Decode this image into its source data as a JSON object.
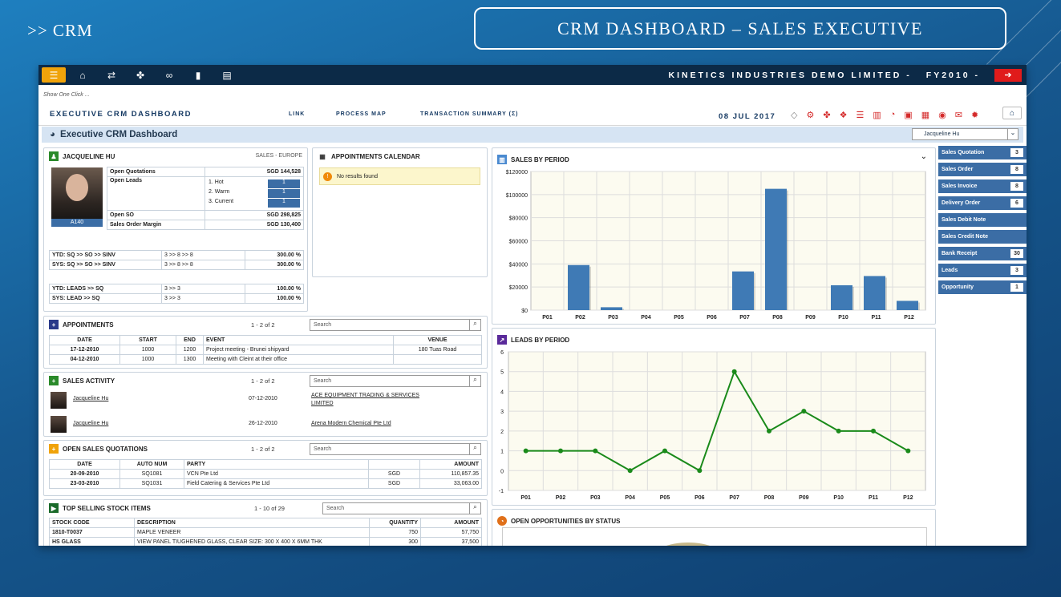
{
  "slide": {
    "title": ">> CRM",
    "banner": "CRM DASHBOARD – SALES EXECUTIVE"
  },
  "topbar": {
    "company": "KINETICS INDUSTRIES DEMO LIMITED -",
    "fy": "FY2010 -"
  },
  "header": {
    "hint": "Show One Click ...",
    "dashboard_title": "EXECUTIVE CRM DASHBOARD",
    "links": [
      "LINK",
      "PROCESS MAP",
      "TRANSACTION SUMMARY (Σ)"
    ],
    "date": "08 JUL 2017"
  },
  "band": {
    "title": "Executive CRM Dashboard",
    "user_select": "Jacqueline Hu"
  },
  "profile": {
    "name": "JACQUELINE HU",
    "region": "SALES - EUROPE",
    "badge": "A140",
    "open_quotations_label": "Open Quotations",
    "open_quotations": "SGD 144,528",
    "open_leads_label": "Open Leads",
    "leads": [
      {
        "label": "1. Hot",
        "value": "1"
      },
      {
        "label": "2. Warm",
        "value": "1"
      },
      {
        "label": "3. Current",
        "value": "1"
      }
    ],
    "open_so_label": "Open SO",
    "open_so": "SGD 298,825",
    "margin_label": "Sales Order Margin",
    "margin": "SGD 130,400",
    "ratios": [
      {
        "label": "YTD: SQ >> SO >> SINV",
        "flow": "3 >> 8 >> 8",
        "pct": "300.00 %"
      },
      {
        "label": "SYS: SQ >> SO >> SINV",
        "flow": "3 >> 8 >> 8",
        "pct": "300.00 %"
      },
      {
        "label": "YTD: LEADS >> SQ",
        "flow": "3 >> 3",
        "pct": "100.00 %"
      },
      {
        "label": "SYS: LEAD >> SQ",
        "flow": "3 >> 3",
        "pct": "100.00 %"
      }
    ]
  },
  "calendar": {
    "title": "APPOINTMENTS CALENDAR",
    "empty": "No results found"
  },
  "appointments": {
    "title": "APPOINTMENTS",
    "paging": "1 - 2 of 2",
    "search": "Search",
    "headers": [
      "DATE",
      "START",
      "END",
      "EVENT",
      "VENUE"
    ],
    "rows": [
      [
        "17-12-2010",
        "1000",
        "1200",
        "Project meeting - Brunei shipyard",
        "180 Tuas Road"
      ],
      [
        "04-12-2010",
        "1000",
        "1300",
        "Meeting with Cleint at their office",
        ""
      ]
    ]
  },
  "sales_activity": {
    "title": "SALES ACTIVITY",
    "paging": "1 - 2 of 2",
    "search": "Search",
    "rows": [
      {
        "name": "Jacqueline Hu",
        "date": "07-12-2010",
        "company": "ACE EQUIPMENT TRADING & SERVICES LIMITED"
      },
      {
        "name": "Jacqueline Hu",
        "date": "26-12-2010",
        "company": "Arena Modern Chemical Pte Ltd"
      }
    ]
  },
  "quotations": {
    "title": "OPEN SALES QUOTATIONS",
    "paging": "1 - 2 of 2",
    "search": "Search",
    "headers": [
      "DATE",
      "AUTO NUM",
      "PARTY",
      "",
      "AMOUNT"
    ],
    "rows": [
      [
        "20-09-2010",
        "SQ1081",
        "VCN Pte Ltd",
        "SGD",
        "110,857.35"
      ],
      [
        "23-03-2010",
        "SQ1031",
        "Field Catering & Services Pte Ltd",
        "SGD",
        "33,063.00"
      ]
    ]
  },
  "stock": {
    "title": "TOP SELLING STOCK ITEMS",
    "paging": "1 - 10 of 29",
    "search": "Search",
    "headers": [
      "STOCK CODE",
      "DESCRIPTION",
      "QUANTITY",
      "AMOUNT"
    ],
    "rows": [
      [
        "1810-T0037",
        "MAPLE VENEER",
        "750",
        "57,750"
      ],
      [
        "HS GLASS",
        "VIEW PANEL TIUGHENED GLASS, CLEAR SIZE: 300 X 400 X 6MM THK",
        "300",
        "37,500"
      ]
    ]
  },
  "sales_chart_title": "SALES BY PERIOD",
  "leads_chart_title": "LEADS BY PERIOD",
  "opps_title": "OPEN OPPORTUNITIES BY STATUS",
  "stats": [
    {
      "label": "Sales Quotation",
      "count": "3"
    },
    {
      "label": "Sales Order",
      "count": "8"
    },
    {
      "label": "Sales Invoice",
      "count": "8"
    },
    {
      "label": "Delivery Order",
      "count": "6"
    },
    {
      "label": "Sales Debit Note",
      "count": ""
    },
    {
      "label": "Sales Credit Note",
      "count": ""
    },
    {
      "label": "Bank Receipt",
      "count": "30"
    },
    {
      "label": "Leads",
      "count": "3"
    },
    {
      "label": "Opportunity",
      "count": "1"
    }
  ],
  "colors": {
    "bar": "#3f7ab5",
    "line": "#1a8a1a",
    "topbar": "#0c2a47",
    "accent": "#f0a30a"
  },
  "chart_data": [
    {
      "type": "bar",
      "title": "SALES BY PERIOD",
      "categories": [
        "P01",
        "P02",
        "P03",
        "P04",
        "P05",
        "P06",
        "P07",
        "P08",
        "P09",
        "P10",
        "P11",
        "P12"
      ],
      "values": [
        0,
        39000,
        2500,
        0,
        0,
        0,
        33500,
        105000,
        0,
        21500,
        29500,
        8000
      ],
      "ylim": [
        0,
        120000
      ],
      "yticks": [
        0,
        20000,
        40000,
        60000,
        80000,
        100000,
        120000
      ],
      "ytick_labels": [
        "$0",
        "$20000",
        "$40000",
        "$60000",
        "$80000",
        "$100000",
        "$120000"
      ],
      "grid": true
    },
    {
      "type": "line",
      "title": "LEADS BY PERIOD",
      "categories": [
        "P01",
        "P02",
        "P03",
        "P04",
        "P05",
        "P06",
        "P07",
        "P08",
        "P09",
        "P10",
        "P11",
        "P12"
      ],
      "values": [
        1,
        1,
        1,
        0,
        1,
        0,
        5,
        2,
        3,
        2,
        2,
        1
      ],
      "ylim": [
        -1,
        6
      ],
      "yticks": [
        -1,
        0,
        1,
        2,
        3,
        4,
        5,
        6
      ],
      "grid": true
    }
  ]
}
